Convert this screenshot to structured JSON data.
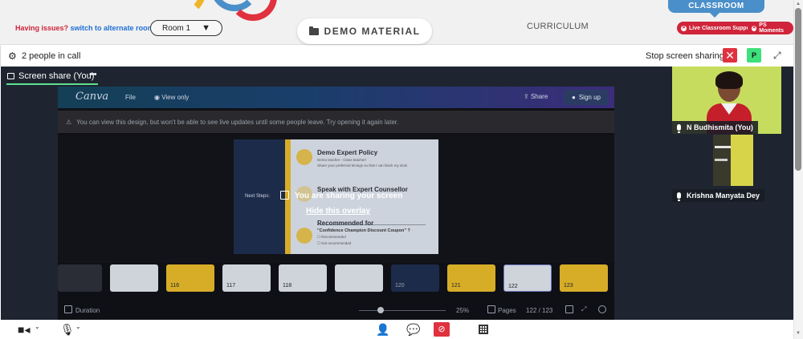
{
  "header": {
    "issues_text": "Having issues?",
    "alternate_link": "switch to alternate room",
    "room_selected": "Room 1",
    "demo_material": "DEMO MATERIAL",
    "curriculum": "CURRICULUM",
    "classroom_tab": "CLASSROOM",
    "live_support": "Live Classroom Support",
    "ps_moments": "PS Moments"
  },
  "call": {
    "people_count": "2 people in call",
    "stop_share": "Stop screen sharing",
    "close_symbol": "✕",
    "p_label": "P"
  },
  "share": {
    "tab_label": "Screen share (You)",
    "more": "•••",
    "overlay_message": "You are sharing your screen",
    "overlay_hide": "Hide this overlay"
  },
  "canva": {
    "logo": "Canva",
    "file": "File",
    "view_only": "View only",
    "share": "Share",
    "sign_up": "Sign up",
    "warning": "You can view this design, but won't be able to see live updates until some people leave. Try opening it again later.",
    "slide": {
      "next_steps": "Next Steps:",
      "item1_title": "Demo Expert Policy",
      "item1_sub": "Demo teacher - Class teacher!",
      "item1_sub2": "Share your preferred timings so that I can block my slots",
      "item2_title": "Speak with Expert Counsellor",
      "item3_title": "Recommended for",
      "item3_sub": "\"Confidence Champion Discount Coupon\" ?",
      "opt1": "Recommended",
      "opt2": "Not recommended"
    },
    "thumbnails": [
      "",
      "",
      "116",
      "117",
      "118",
      "",
      "120",
      "121",
      "122",
      "123"
    ],
    "duration": "Duration",
    "zoom": "25%",
    "pages": "Pages",
    "page_count": "122 / 123"
  },
  "participants": [
    {
      "name": "N Budhismita (You)"
    },
    {
      "name": "Krishna Manyata Dey"
    }
  ],
  "colors": {
    "accent_red": "#d0243a",
    "link_blue": "#1e6fd6",
    "classroom_blue": "#4a8fc9",
    "active_green": "#5ee08e",
    "stage_dark": "#1e2530"
  },
  "icons": {
    "settings": "gear-icon",
    "camera": "video-camera-icon",
    "microphone": "microphone-icon",
    "participants": "person-icon",
    "chat": "chat-bubble-icon",
    "whiteboard": "whiteboard-off-icon",
    "layout": "grid-icon"
  }
}
